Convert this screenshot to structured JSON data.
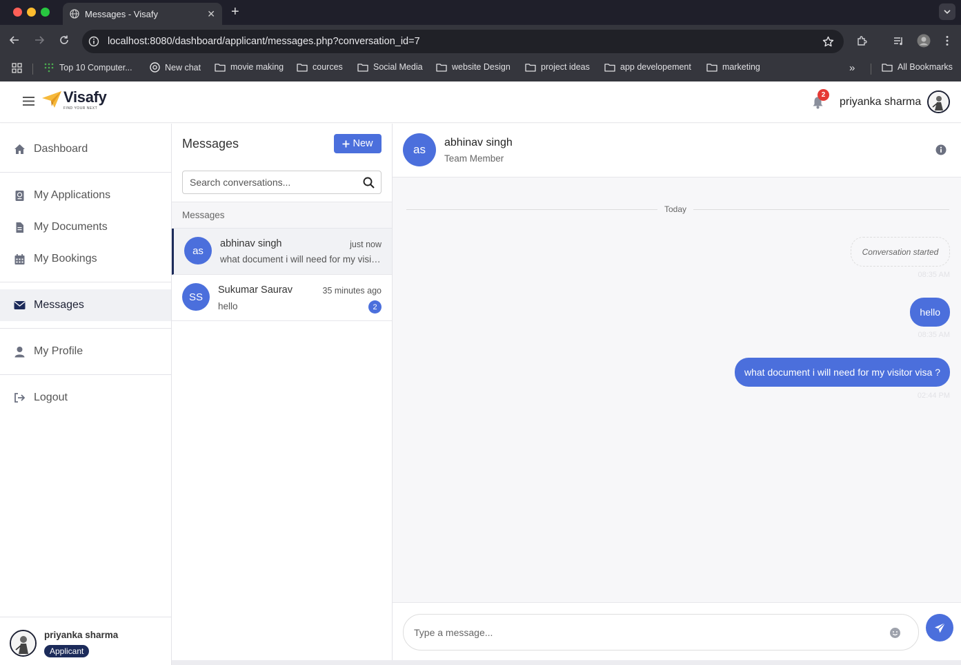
{
  "browser": {
    "tab_title": "Messages - Visafy",
    "url": "localhost:8080/dashboard/applicant/messages.php?conversation_id=7",
    "bookmarks": [
      "Top 10 Computer...",
      "New chat",
      "movie making",
      "cources",
      "Social Media",
      "website Design",
      "project ideas",
      "app developement",
      "marketing"
    ],
    "all_bookmarks": "All Bookmarks"
  },
  "app": {
    "logo_text": "Visafy",
    "logo_tagline": "FIND YOUR NEXT",
    "notification_count": "2",
    "user_name": "priyanka sharma"
  },
  "sidebar": {
    "items": [
      {
        "label": "Dashboard",
        "icon": "home-icon"
      },
      {
        "label": "My Applications",
        "icon": "passport-icon"
      },
      {
        "label": "My Documents",
        "icon": "document-icon"
      },
      {
        "label": "My Bookings",
        "icon": "calendar-icon"
      },
      {
        "label": "Messages",
        "icon": "envelope-icon"
      },
      {
        "label": "My Profile",
        "icon": "user-icon"
      },
      {
        "label": "Logout",
        "icon": "logout-icon"
      }
    ],
    "active": "Messages",
    "user_name": "priyanka sharma",
    "user_role": "Applicant"
  },
  "conversations": {
    "title": "Messages",
    "new_button": "New",
    "search_placeholder": "Search conversations...",
    "section_label": "Messages",
    "items": [
      {
        "initials": "as",
        "name": "abhinav singh",
        "time": "just now",
        "preview": "what document i will need for my visit...",
        "unread": ""
      },
      {
        "initials": "SS",
        "name": "Sukumar Saurav",
        "time": "35 minutes ago",
        "preview": "hello",
        "unread": "2"
      }
    ]
  },
  "chat": {
    "initials": "as",
    "name": "abhinav singh",
    "role": "Team Member",
    "date_divider": "Today",
    "system_message": "Conversation started",
    "system_time": "08:35 AM",
    "messages": [
      {
        "text": "hello",
        "time": "08:35 AM"
      },
      {
        "text": "what document i will need for my visitor visa ?",
        "time": "02:44 PM"
      }
    ],
    "input_placeholder": "Type a message..."
  },
  "colors": {
    "accent": "#4b6fdc",
    "navy": "#1c2b5a",
    "badge_red": "#e53935"
  }
}
